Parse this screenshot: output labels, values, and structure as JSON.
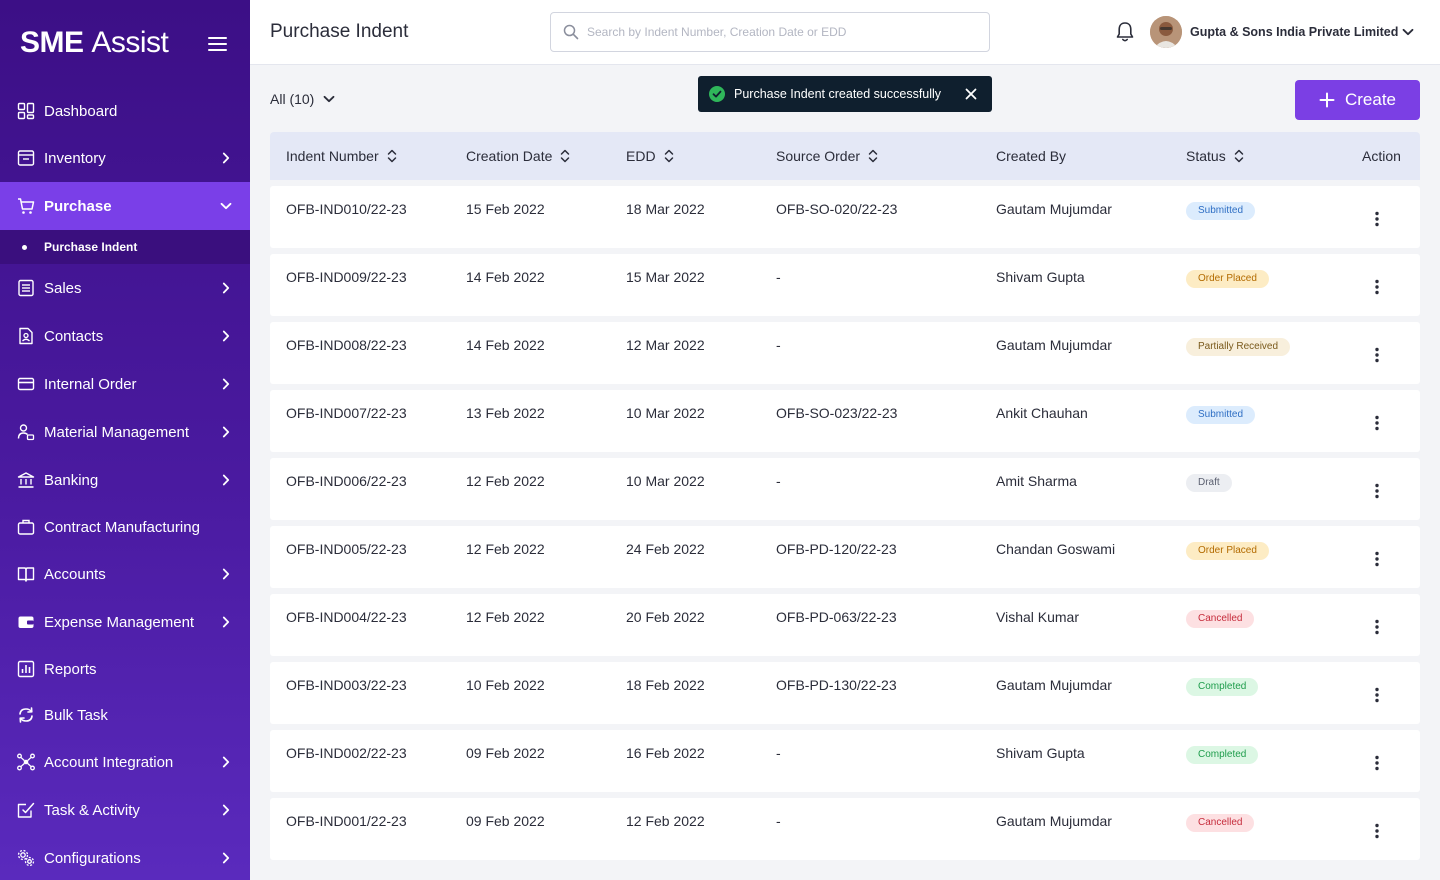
{
  "brand": {
    "name_bold": "SME",
    "name_light": "Assist"
  },
  "sidebar": {
    "items": [
      {
        "label": "Dashboard",
        "icon": "dashboard-icon"
      },
      {
        "label": "Inventory",
        "icon": "inventory-icon"
      },
      {
        "label": "Purchase",
        "icon": "cart-icon"
      },
      {
        "label": "Sales",
        "icon": "sales-icon"
      },
      {
        "label": "Contacts",
        "icon": "contacts-icon"
      },
      {
        "label": "Internal Order",
        "icon": "card-icon"
      },
      {
        "label": "Material Management",
        "icon": "material-icon"
      },
      {
        "label": "Banking",
        "icon": "bank-icon"
      },
      {
        "label": "Contract Manufacturing",
        "icon": "briefcase-icon"
      },
      {
        "label": "Accounts",
        "icon": "book-icon"
      },
      {
        "label": "Expense Management",
        "icon": "wallet-icon"
      },
      {
        "label": "Reports",
        "icon": "reports-icon"
      },
      {
        "label": "Bulk Task",
        "icon": "sync-icon"
      },
      {
        "label": "Account Integration",
        "icon": "network-icon"
      },
      {
        "label": "Task & Activity",
        "icon": "task-icon"
      },
      {
        "label": "Configurations",
        "icon": "config-icon"
      }
    ],
    "sub_item": "Purchase Indent"
  },
  "header": {
    "title": "Purchase Indent",
    "search_placeholder": "Search by Indent Number, Creation Date or EDD",
    "company": "Gupta & Sons India Private Limited"
  },
  "toolbar": {
    "filter_label": "All (10)",
    "toast_message": "Purchase Indent created successfully",
    "create_label": "Create"
  },
  "table": {
    "columns": [
      "Indent Number",
      "Creation Date",
      "EDD",
      "Source Order",
      "Created By",
      "Status",
      "Action"
    ],
    "rows": [
      {
        "indent": "OFB-IND010/22-23",
        "created": "15 Feb 2022",
        "edd": "18 Mar 2022",
        "source": "OFB-SO-020/22-23",
        "by": "Gautam Mujumdar",
        "status": "Submitted"
      },
      {
        "indent": "OFB-IND009/22-23",
        "created": "14 Feb 2022",
        "edd": "15 Mar 2022",
        "source": "-",
        "by": "Shivam Gupta",
        "status": "Order Placed"
      },
      {
        "indent": "OFB-IND008/22-23",
        "created": "14 Feb 2022",
        "edd": "12 Mar 2022",
        "source": "-",
        "by": "Gautam Mujumdar",
        "status": "Partially Received"
      },
      {
        "indent": "OFB-IND007/22-23",
        "created": "13 Feb 2022",
        "edd": "10 Mar 2022",
        "source": "OFB-SO-023/22-23",
        "by": "Ankit Chauhan",
        "status": "Submitted"
      },
      {
        "indent": "OFB-IND006/22-23",
        "created": "12 Feb 2022",
        "edd": "10 Mar 2022",
        "source": "-",
        "by": "Amit Sharma",
        "status": "Draft"
      },
      {
        "indent": "OFB-IND005/22-23",
        "created": "12 Feb 2022",
        "edd": "24 Feb 2022",
        "source": "OFB-PD-120/22-23",
        "by": "Chandan Goswami",
        "status": "Order Placed"
      },
      {
        "indent": "OFB-IND004/22-23",
        "created": "12 Feb 2022",
        "edd": "20 Feb 2022",
        "source": "OFB-PD-063/22-23",
        "by": "Vishal Kumar",
        "status": "Cancelled"
      },
      {
        "indent": "OFB-IND003/22-23",
        "created": "10 Feb 2022",
        "edd": "18 Feb 2022",
        "source": "OFB-PD-130/22-23",
        "by": "Gautam Mujumdar",
        "status": "Completed"
      },
      {
        "indent": "OFB-IND002/22-23",
        "created": "09 Feb 2022",
        "edd": "16 Feb 2022",
        "source": "-",
        "by": "Shivam Gupta",
        "status": "Completed"
      },
      {
        "indent": "OFB-IND001/22-23",
        "created": "09 Feb 2022",
        "edd": "12 Feb 2022",
        "source": "-",
        "by": "Gautam Mujumdar",
        "status": "Cancelled"
      }
    ]
  },
  "status_colors": {
    "Submitted": {
      "bg": "#dcecfd",
      "fg": "#2f6fc4"
    },
    "Order Placed": {
      "bg": "#fdecc4",
      "fg": "#b36b00"
    },
    "Partially Received": {
      "bg": "#f8efdc",
      "fg": "#7a5a1c"
    },
    "Draft": {
      "bg": "#eceef2",
      "fg": "#5b6070"
    },
    "Cancelled": {
      "bg": "#fde0e2",
      "fg": "#c62c3c"
    },
    "Completed": {
      "bg": "#dcf7e4",
      "fg": "#1f9d4c"
    }
  },
  "colors": {
    "accent": "#7b3fe4",
    "sidebar": "#3c0f86"
  }
}
